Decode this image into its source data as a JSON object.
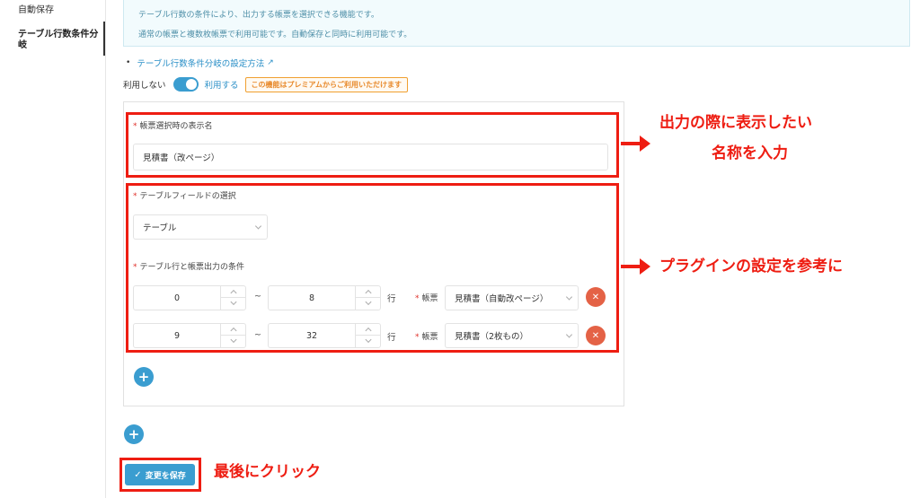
{
  "sidebar": {
    "items": [
      {
        "label": "自動保存"
      },
      {
        "label": "テーブル行数条件分岐"
      }
    ]
  },
  "info": {
    "line1": "テーブル行数の条件により、出力する帳票を選択できる機能です。",
    "line2": "通常の帳票と複数枚帳票で利用可能です。自動保存と同時に利用可能です。"
  },
  "help_link": {
    "bullet": "•",
    "label": "テーブル行数条件分岐の設定方法",
    "icon": "external-link-icon"
  },
  "toggle": {
    "off_label": "利用しない",
    "on_label": "利用する",
    "state": "on",
    "premium_badge": "この機能はプレミアムからご利用いただけます"
  },
  "form": {
    "required_mark": "*",
    "display_name": {
      "label": "帳票選択時の表示名",
      "value": "見積書（改ページ）"
    },
    "table_field": {
      "label": "テーブルフィールドの選択",
      "value": "テーブル"
    },
    "conditions": {
      "label": "テーブル行と帳票出力の条件",
      "tilde": "~",
      "row_unit": "行",
      "report_label": "帳票",
      "rows": [
        {
          "from": "0",
          "to": "8",
          "report": "見積書（自動改ページ）"
        },
        {
          "from": "9",
          "to": "32",
          "report": "見積書（2枚もの）"
        }
      ]
    }
  },
  "save_button": {
    "label": "変更を保存",
    "icon": "check-icon"
  },
  "annotations": {
    "a1_line1": "出力の際に表示したい",
    "a1_line2": "名称を入力",
    "a2": "プラグインの設定を参考に",
    "a3": "最後にクリック"
  },
  "colors": {
    "accent": "#3a9dd0",
    "annotation_red": "#ee1d12",
    "delete": "#e46246",
    "premium": "#e8892a"
  }
}
